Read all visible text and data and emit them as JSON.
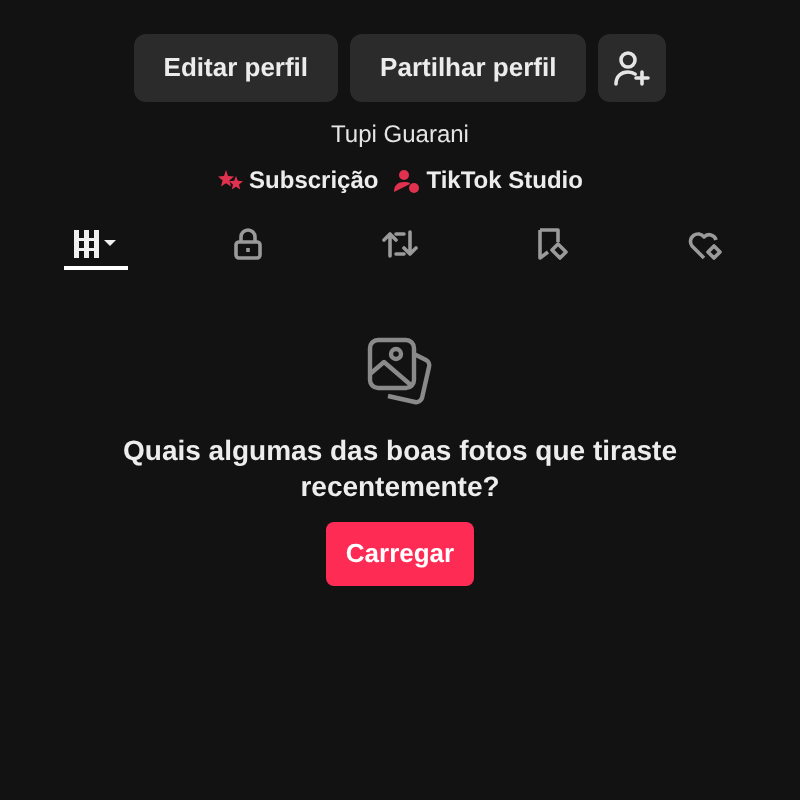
{
  "buttons": [
    {
      "kind": "text",
      "label": "Editar perfil"
    },
    {
      "kind": "text",
      "label": "Partilhar perfil"
    },
    {
      "kind": "add-friend"
    }
  ],
  "bio": "Tupi Guarani",
  "links": [
    {
      "kind": "subscription",
      "label": "Subscrição"
    },
    {
      "kind": "studio",
      "label": "TikTok Studio"
    }
  ],
  "tabs": [
    {
      "kind": "grid",
      "selected": true
    },
    {
      "kind": "lock",
      "selected": false
    },
    {
      "kind": "repost",
      "selected": false
    },
    {
      "kind": "bookmark",
      "selected": false
    },
    {
      "kind": "liked",
      "selected": false
    }
  ],
  "empty": {
    "message": "Quais algumas das boas fotos que tiraste recentemente?",
    "button": "Carregar"
  }
}
